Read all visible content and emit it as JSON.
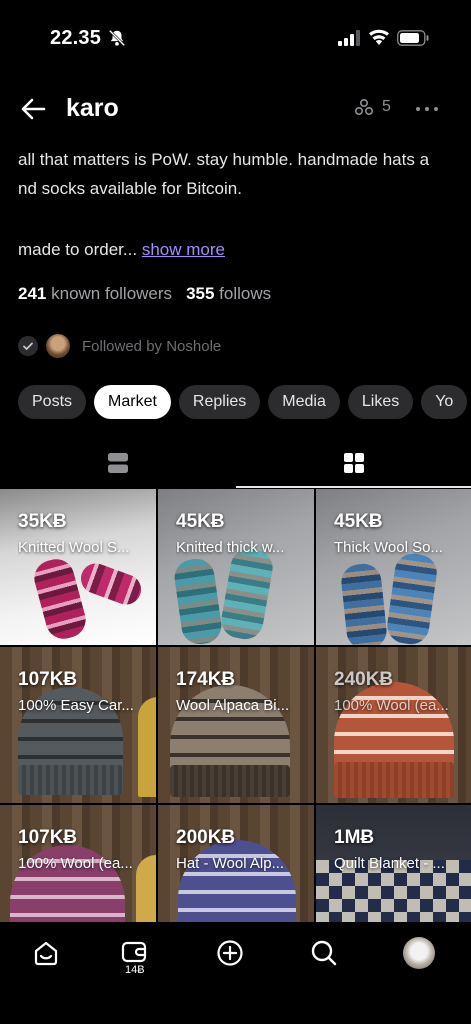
{
  "status": {
    "time": "22.35"
  },
  "header": {
    "name": "karo",
    "zap_count": "5"
  },
  "bio": {
    "line1": "all that matters is PoW. stay humble. handmade hats a",
    "line2": "nd socks available for Bitcoin.",
    "line3": "made to order...",
    "show_more": "show more"
  },
  "stats": {
    "followers_count": "241",
    "followers_label": "known followers",
    "follows_count": "355",
    "follows_label": "follows"
  },
  "followed_by": "Followed by Noshole",
  "tabs": [
    {
      "label": "Posts",
      "active": false
    },
    {
      "label": "Market",
      "active": true
    },
    {
      "label": "Replies",
      "active": false
    },
    {
      "label": "Media",
      "active": false
    },
    {
      "label": "Likes",
      "active": false
    },
    {
      "label": "Yo",
      "active": false
    }
  ],
  "products": [
    {
      "price": "35KɃ",
      "title": "Knitted Wool S..."
    },
    {
      "price": "45KɃ",
      "title": "Knitted thick w..."
    },
    {
      "price": "45KɃ",
      "title": "Thick Wool So..."
    },
    {
      "price": "107KɃ",
      "title": "100% Easy Car..."
    },
    {
      "price": "174KɃ",
      "title": "Wool Alpaca Bi..."
    },
    {
      "price": "240KɃ",
      "title": "100% Wool (ea..."
    },
    {
      "price": "107KɃ",
      "title": "100% Wool (ea..."
    },
    {
      "price": "200KɃ",
      "title": "Hat - Wool Alp..."
    },
    {
      "price": "1MɃ",
      "title": "Quilt Blanket - ..."
    }
  ],
  "nav": {
    "wallet_badge": "14Ƀ"
  }
}
